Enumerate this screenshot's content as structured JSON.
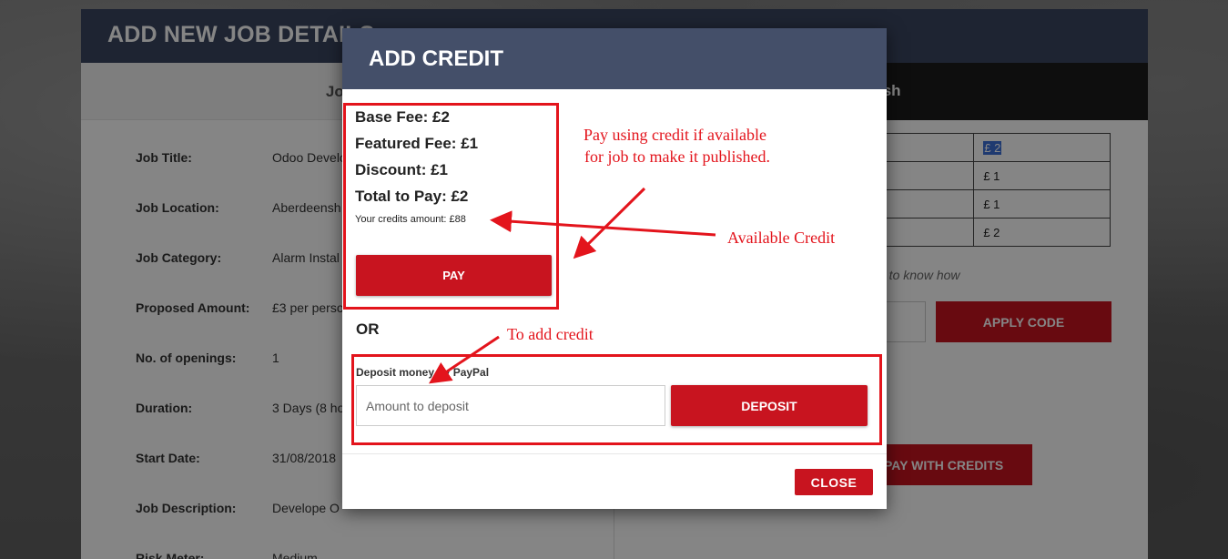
{
  "page": {
    "title": "ADD NEW JOB DETAILS",
    "left_tab": "Job D",
    "right_tab": "ish",
    "details": [
      {
        "label": "Job Title:",
        "value": "Odoo Develo"
      },
      {
        "label": "Job Location:",
        "value": "Aberdeensh"
      },
      {
        "label": "Job Category:",
        "value": "Alarm Instal"
      },
      {
        "label": "Proposed Amount:",
        "value": "£3 per perso"
      },
      {
        "label": "No. of openings:",
        "value": "1"
      },
      {
        "label": "Duration:",
        "value": "3 Days (8 ho"
      },
      {
        "label": "Start Date:",
        "value": "31/08/2018"
      },
      {
        "label": "Job Description:",
        "value": "Develope O"
      },
      {
        "label": "Risk Meter:",
        "value": "Medium"
      }
    ],
    "fee_table": [
      "£ 2",
      "£ 1",
      "£ 1",
      "£ 2"
    ],
    "promo_hint": "e to know how",
    "apply_code_label": "APPLY CODE",
    "pay_with_credits_label": "PAY WITH CREDITS"
  },
  "modal": {
    "title": "ADD CREDIT",
    "base_fee": "Base Fee: £2",
    "featured_fee": "Featured Fee: £1",
    "discount": "Discount: £1",
    "total": "Total to Pay: £2",
    "credits_amount": "Your credits amount: £88",
    "pay_label": "PAY",
    "or_label": "OR",
    "deposit_label": "Deposit money by PayPal",
    "deposit_placeholder": "Amount to deposit",
    "deposit_button": "DEPOSIT",
    "close_label": "CLOSE"
  },
  "annotations": {
    "pay_note_line1": "Pay using credit if available",
    "pay_note_line2": "for job to make it published.",
    "available_credit": "Available Credit",
    "add_credit": "To add credit",
    "color": "#e3141c"
  },
  "colors": {
    "header_bg": "#3a4560",
    "modal_header_bg": "#444f69",
    "accent_red": "#c8141f"
  }
}
